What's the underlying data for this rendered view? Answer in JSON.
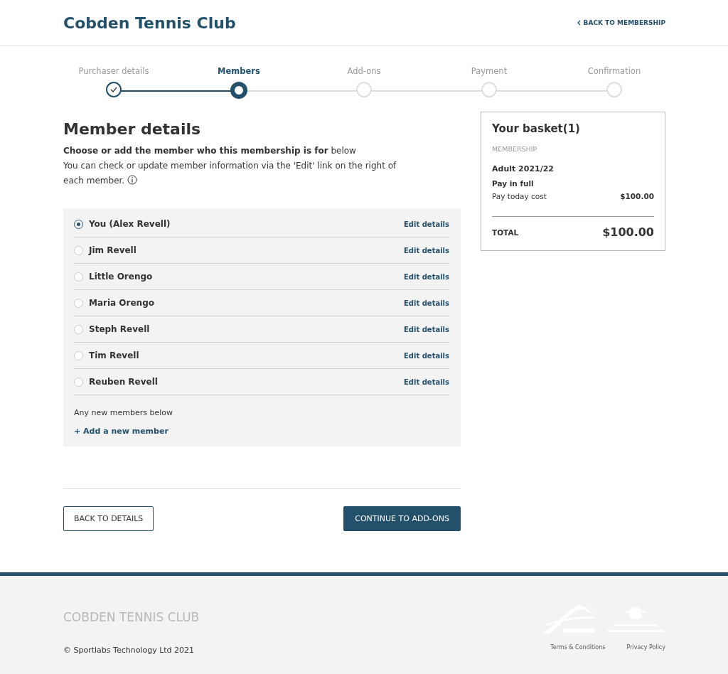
{
  "header": {
    "title": "Cobden Tennis Club",
    "back_link": "BACK TO MEMBERSHIP"
  },
  "steps": [
    {
      "label": "Purchaser details",
      "completed": true,
      "selected": false
    },
    {
      "label": "Members",
      "completed": false,
      "selected": true
    },
    {
      "label": "Add-ons",
      "completed": false,
      "selected": false
    },
    {
      "label": "Payment",
      "completed": false,
      "selected": false
    },
    {
      "label": "Confirmation",
      "completed": false,
      "selected": false
    }
  ],
  "main": {
    "heading": "Member details",
    "intro": "**Choose or add the member who this membership is for** below",
    "help_lines": [
      "You can check or update member information via the 'Edit' link on the right of",
      "each member."
    ],
    "members": [
      {
        "name": "You (Alex Revell)",
        "selected": true,
        "edit": "Edit details"
      },
      {
        "name": "Jim Revell",
        "selected": false,
        "edit": "Edit details"
      },
      {
        "name": "Little Orengo",
        "selected": false,
        "edit": "Edit details"
      },
      {
        "name": "Maria Orengo",
        "selected": false,
        "edit": "Edit details"
      },
      {
        "name": "Steph Revell",
        "selected": false,
        "edit": "Edit details"
      },
      {
        "name": "Tim Revell",
        "selected": false,
        "edit": "Edit details"
      },
      {
        "name": "Reuben Revell",
        "selected": false,
        "edit": "Edit details"
      }
    ],
    "new_members_note": "Any new members below",
    "add_member": "+ Add a new member",
    "buttons": {
      "back": "BACK TO DETAILS",
      "continue": "CONTINUE TO ADD-ONS"
    }
  },
  "basket": {
    "title": "Your basket(1)",
    "category": "MEMBERSHIP",
    "item": "Adult 2021/22",
    "plan": "Pay in full",
    "cost_label": "Pay today cost",
    "cost": "$100.00",
    "total_label": "TOTAL",
    "total": "$100.00"
  },
  "footer": {
    "club": "COBDEN TENNIS CLUB",
    "copyright": "© Sportlabs Technology Ltd 2021",
    "links": [
      "Terms & Conditions",
      "Privacy Policy"
    ]
  }
}
